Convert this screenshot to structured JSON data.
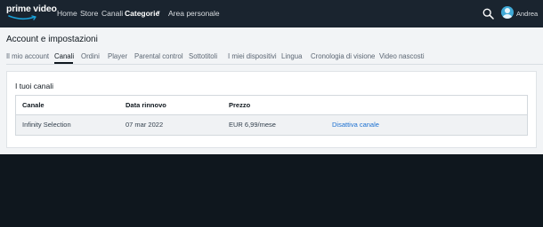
{
  "header": {
    "logo_text": "prime video",
    "nav": {
      "home": "Home",
      "store": "Store",
      "channels": "Canali",
      "categories": "Categorie",
      "personal_area": "Area personale"
    },
    "user_name": "Andrea"
  },
  "page": {
    "title": "Account e impostazioni",
    "tabs": [
      {
        "label": "Il mio account"
      },
      {
        "label": "Canali",
        "active": true
      },
      {
        "label": "Ordini"
      },
      {
        "label": "Player"
      },
      {
        "label": "Parental control"
      },
      {
        "label": "Sottotitoli"
      },
      {
        "label": "I miei dispositivi"
      },
      {
        "label": "Lingua"
      },
      {
        "label": "Cronologia di visione"
      },
      {
        "label": "Video nascosti"
      }
    ]
  },
  "channels_card": {
    "title": "I tuoi canali",
    "columns": [
      "Canale",
      "Data rinnovo",
      "Prezzo"
    ],
    "rows": [
      {
        "channel": "Infinity Selection",
        "renewal_date": "07 mar 2022",
        "price": "EUR 6,99/mese",
        "action": "Disattiva canale"
      }
    ]
  },
  "colors": {
    "header_bg": "#1a242f",
    "page_bg": "#0f171e",
    "content_bg": "#f2f4f6",
    "link": "#1a6fd1"
  }
}
